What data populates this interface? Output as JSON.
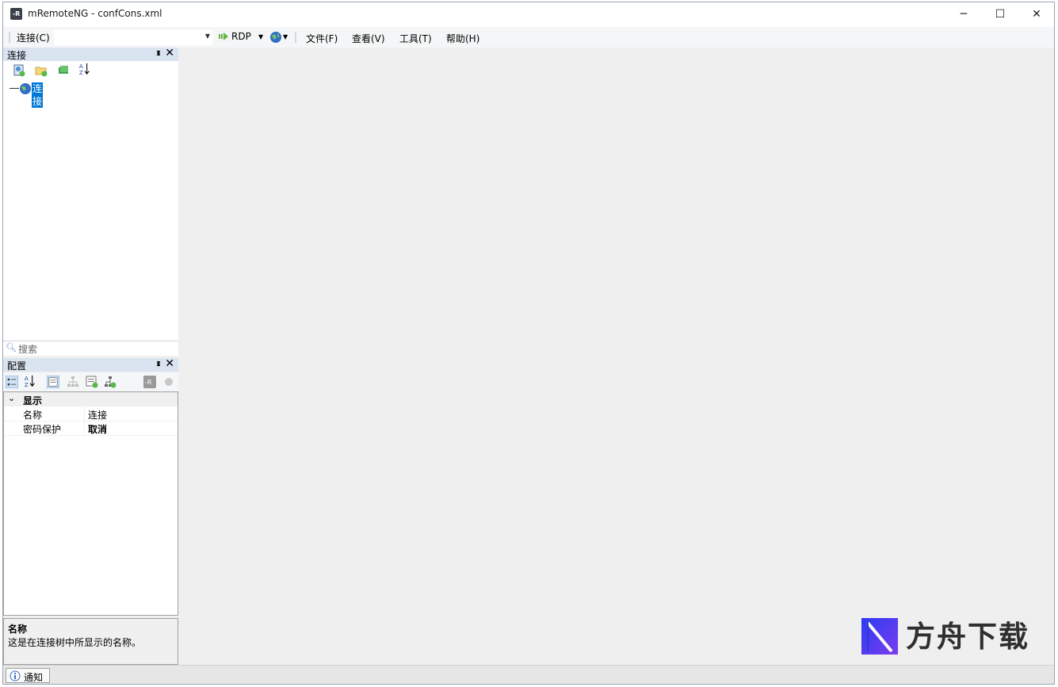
{
  "window": {
    "title": "mRemoteNG - confCons.xml",
    "app_icon_text": "-R",
    "minimize": "─",
    "maximize": "☐",
    "close": "✕"
  },
  "toolbar": {
    "connect_label": "连接(C)",
    "connect_value": "",
    "protocol": "RDP",
    "menus": [
      "文件(F)",
      "查看(V)",
      "工具(T)",
      "帮助(H)"
    ]
  },
  "connections_panel": {
    "title": "连接",
    "pin": "ᵻ",
    "close": "✕",
    "sort_label_a": "A",
    "sort_label_z": "Z",
    "root_node": "连接",
    "search_placeholder": "搜索"
  },
  "config_panel": {
    "title": "配置",
    "pin": "ᵻ",
    "close": "✕",
    "sort_label_a": "A",
    "sort_label_z": "Z",
    "category": "显示",
    "properties": [
      {
        "name": "名称",
        "value": "连接",
        "bold": false
      },
      {
        "name": "密码保护",
        "value": "取消",
        "bold": true
      }
    ],
    "description_title": "名称",
    "description_text": "这是在连接树中所显示的名称。"
  },
  "statusbar": {
    "notify_tab": "通知"
  },
  "watermark": {
    "text": "方舟下载"
  },
  "colors": {
    "panel_header": "#dae3f0",
    "selection": "#0078d7",
    "workspace": "#efefef"
  }
}
